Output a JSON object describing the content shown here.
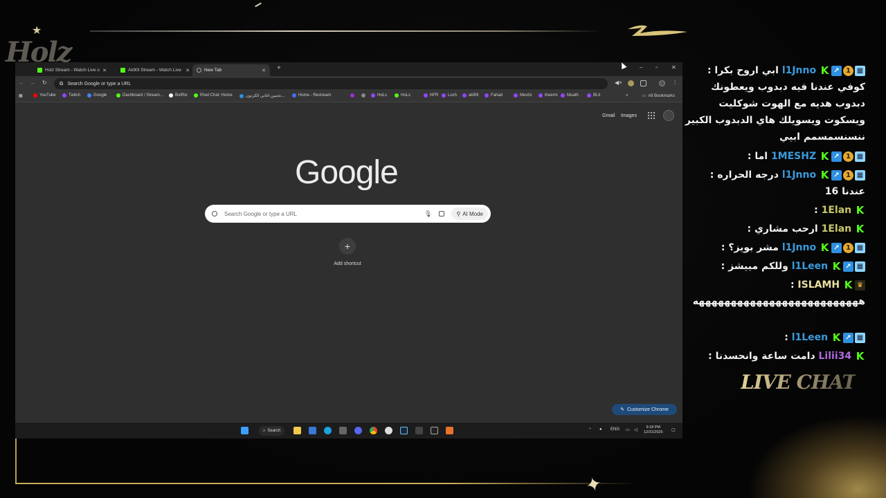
{
  "overlay": {
    "logo_text": "Holz",
    "live_chat_label": "LIVE CHAT"
  },
  "browser": {
    "tabs": [
      {
        "label": "Holz Stream - Watch Live on Ki",
        "icon": "kick-icon"
      },
      {
        "label": "Ak90l Stream - Watch Live on K",
        "icon": "kick-icon"
      },
      {
        "label": "New Tab",
        "icon": "globe-icon",
        "active": true
      }
    ],
    "omnibox_placeholder": "Search Google or type a URL",
    "bookmarks": [
      {
        "label": "YouTube",
        "color": "#ff0000"
      },
      {
        "label": "Twitch",
        "color": "#9146ff"
      },
      {
        "label": "Google",
        "color": "#4285f4"
      },
      {
        "label": "Dashboard / Stream...",
        "color": "#53fc18"
      },
      {
        "label": "BotRix",
        "color": "#ffffff"
      },
      {
        "label": "Pixel Chat: Home",
        "color": "#53fc18"
      },
      {
        "label": "تخمين اغاني الكرتون...",
        "color": "#2f8fe0"
      },
      {
        "label": "Home - Restream",
        "color": "#4a6cf7"
      },
      {
        "label": "",
        "color": "#a12bd8"
      },
      {
        "label": "",
        "color": "#888888"
      },
      {
        "label": "HoLs",
        "color": "#9146ff"
      },
      {
        "label": "HoLs",
        "color": "#53fc18"
      },
      {
        "label": "NFR",
        "color": "#9146ff"
      },
      {
        "label": "Lozh",
        "color": "#9146ff"
      },
      {
        "label": "ak90l",
        "color": "#9146ff"
      },
      {
        "label": "Fahad",
        "color": "#9146ff"
      },
      {
        "label": "Meshz",
        "color": "#9146ff"
      },
      {
        "label": "Kwerm",
        "color": "#9146ff"
      },
      {
        "label": "Muath",
        "color": "#9146ff"
      },
      {
        "label": "BLll",
        "color": "#9146ff"
      }
    ],
    "all_bookmarks": "All Bookmarks",
    "page": {
      "gmail": "Gmail",
      "images": "Images",
      "logo": "Google",
      "search_placeholder": "Search Google or type a URL",
      "ai_mode": "AI Mode",
      "add_shortcut": "Add shortcut",
      "customize": "Customize Chrome"
    },
    "taskbar": {
      "search": "Search",
      "lang": "ENG",
      "time": "9:18 PM",
      "date": "12/31/2025"
    }
  },
  "chat": {
    "messages": [
      {
        "name": "l1Jnno",
        "name_color": "#3a9bdc",
        "badges": [
          "kick",
          "sub",
          "gift",
          "bot"
        ],
        "text": "ابي اروح بكرا : كوفي عندنا فيه دبدوب ويعطونك دبدوب هديه مع الهوت شوكليت ويسكوت ويسويلك هاي الدبدوب الكبير ننسنسمسمم ابيي"
      },
      {
        "name": "1MESHZ",
        "name_color": "#3a9bdc",
        "badges": [
          "kick",
          "sub",
          "gift",
          "bot"
        ],
        "text": "اما :"
      },
      {
        "name": "l1Jnno",
        "name_color": "#3a9bdc",
        "badges": [
          "kick",
          "sub",
          "gift",
          "bot"
        ],
        "text": "درجه الحراره : عندنا 16"
      },
      {
        "name": "1Elan",
        "name_color": "#c9c96a",
        "badges": [
          "kick"
        ],
        "text": ":"
      },
      {
        "name": "1Elan",
        "name_color": "#c9c96a",
        "badges": [
          "kick"
        ],
        "text": "ارحب مشاري :"
      },
      {
        "name": "l1Jnno",
        "name_color": "#3a9bdc",
        "badges": [
          "kick",
          "sub",
          "gift",
          "bot"
        ],
        "text": "مشر بويز؟ :"
      },
      {
        "name": "l1Leen",
        "name_color": "#3a9bdc",
        "badges": [
          "kick",
          "sub",
          "bot"
        ],
        "text": "وللكم مييشز :"
      },
      {
        "name": "ISLAMH",
        "name_color": "#e8e0a0",
        "badges": [
          "kick",
          "crown"
        ],
        "text": ": ههههههههههههههههههههههههههه"
      },
      {
        "name": "l1Leen",
        "name_color": "#3a9bdc",
        "badges": [
          "kick",
          "sub",
          "bot"
        ],
        "text": ":"
      },
      {
        "name": "Lilii34",
        "name_color": "#b06ae0",
        "badges": [
          "kick"
        ],
        "text": "دامت ساعة وانحسدنا :"
      }
    ]
  }
}
